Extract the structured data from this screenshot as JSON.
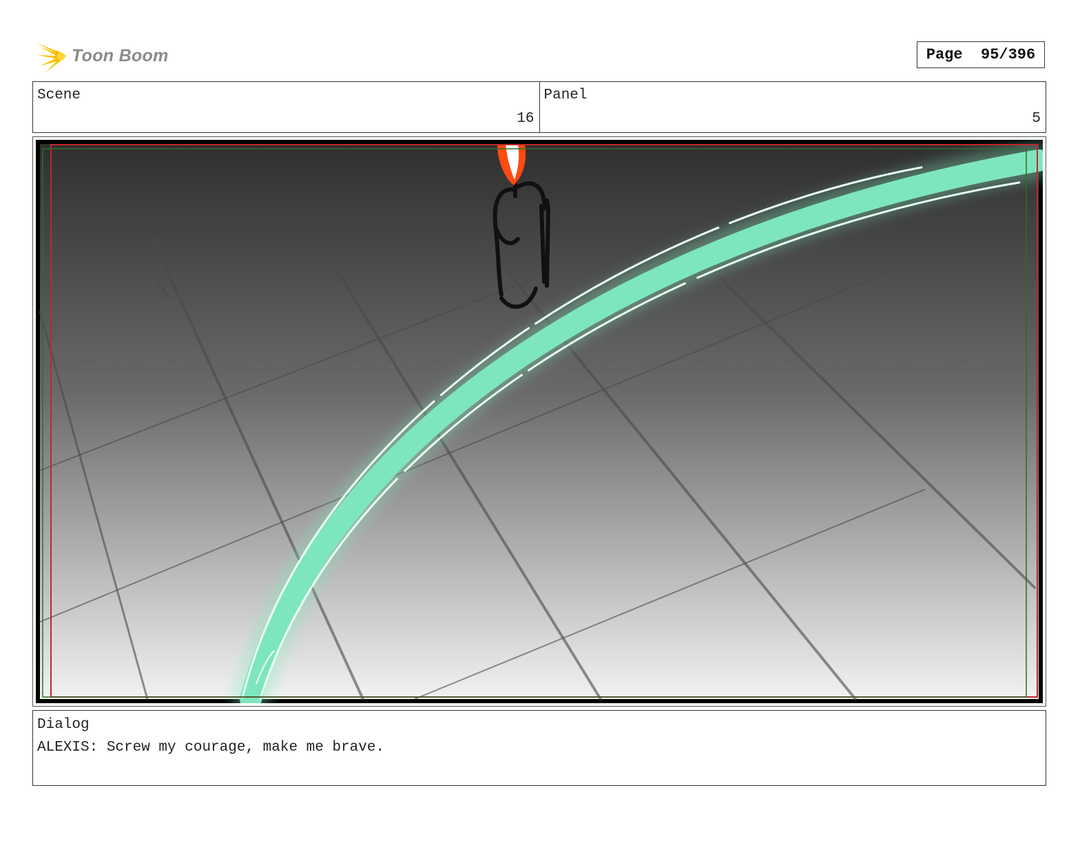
{
  "header": {
    "logo_text": "Toon Boom",
    "page_label": "Page",
    "page_number": "95/396"
  },
  "info": {
    "scene_label": "Scene",
    "scene_value": "16",
    "panel_label": "Panel",
    "panel_value": "5"
  },
  "dialog": {
    "label": "Dialog",
    "text": "ALEXIS: Screw my courage, make me brave."
  },
  "colors": {
    "glow": "#7fe8be",
    "glow_core": "#e6fff4",
    "flame": "#ff4a10",
    "safe_red": "#c0262b",
    "safe_green": "#2e6b2e"
  }
}
